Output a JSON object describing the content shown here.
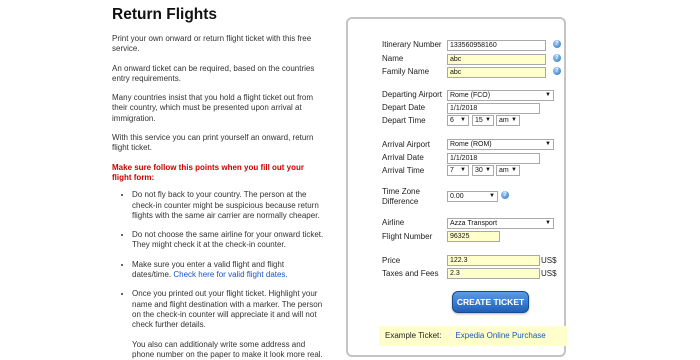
{
  "intro": {
    "title": "Return Flights",
    "p1": "Print your own onward or return flight ticket with this free service.",
    "p2": "An onward ticket can be required, based on the countries entry requirements.",
    "p3": "Many countries insist that you hold a flight ticket out from their country, which must be presented upon arrival at immigration.",
    "p4": "With this service you can print yourself an onward, return flight ticket.",
    "warning": "Make sure follow this points when you fill out your flight form:",
    "bullets": [
      "Do not fly back to your country. The person at the check-in counter might be suspicious because return flights with the same air carrier are normally cheaper.",
      "Do not choose the same airline for your onward ticket. They might check it at the check-in counter.",
      "Make sure you enter a valid flight and flight dates/time.",
      "Once you printed out your flight ticket. Highlight your name and flight destination with a marker. The person on the check-in counter will appreciate it and will not check further details."
    ],
    "bullet3_link": "Check here for valid flight dates.",
    "extra": "You also can additionaly write some address and phone number on the paper to make it look more real."
  },
  "form": {
    "itinerary_label": "Itinerary Number",
    "itinerary_value": "133560958160",
    "name_label": "Name",
    "name_value": "abc",
    "family_label": "Family Name",
    "family_value": "abc",
    "dep_airport_label": "Departing Airport",
    "dep_airport_value": "Rome (FCO)",
    "dep_date_label": "Depart Date",
    "dep_date_value": "1/1/2018",
    "dep_time_label": "Depart Time",
    "dep_hour": "6",
    "dep_min": "15",
    "dep_ampm": "am",
    "arr_airport_label": "Arrival Airport",
    "arr_airport_value": "Rome (ROM)",
    "arr_date_label": "Arrival Date",
    "arr_date_value": "1/1/2018",
    "arr_time_label": "Arrival Time",
    "arr_hour": "7",
    "arr_min": "30",
    "arr_ampm": "am",
    "tz_label_1": "Time Zone",
    "tz_label_2": "Difference",
    "tz_value": "0.00",
    "airline_label": "Airline",
    "airline_value": "Azza Transport",
    "flight_label": "Flight Number",
    "flight_value": "96325",
    "price_label": "Price",
    "price_value": "122.3",
    "taxes_label": "Taxes and Fees",
    "taxes_value": "2.3",
    "currency": "US$",
    "help_glyph": "?",
    "dropdown_glyph": "▼",
    "submit_label": "CREATE TICKET",
    "example_label": "Example  Ticket:",
    "example_link": "Expedia Online Purchase"
  }
}
